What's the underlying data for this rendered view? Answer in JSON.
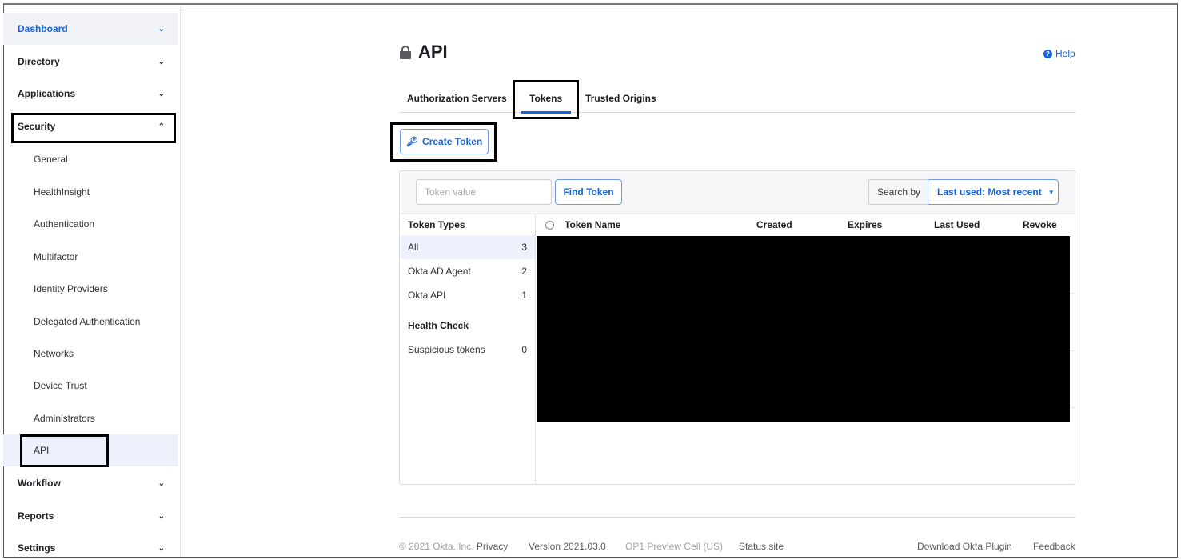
{
  "sidebar": {
    "items": [
      {
        "label": "Dashboard",
        "chevron": "chevron-down-icon"
      },
      {
        "label": "Directory",
        "chevron": "chevron-down-icon"
      },
      {
        "label": "Applications",
        "chevron": "chevron-down-icon"
      },
      {
        "label": "Security",
        "chevron": "chevron-up-icon"
      },
      {
        "label": "Workflow",
        "chevron": "chevron-down-icon"
      },
      {
        "label": "Reports",
        "chevron": "chevron-down-icon"
      },
      {
        "label": "Settings",
        "chevron": "chevron-down-icon"
      }
    ],
    "security_sub": [
      {
        "label": "General"
      },
      {
        "label": "HealthInsight"
      },
      {
        "label": "Authentication"
      },
      {
        "label": "Multifactor"
      },
      {
        "label": "Identity Providers"
      },
      {
        "label": "Delegated Authentication"
      },
      {
        "label": "Networks"
      },
      {
        "label": "Device Trust"
      },
      {
        "label": "Administrators"
      },
      {
        "label": "API"
      }
    ]
  },
  "header": {
    "title": "API",
    "title_icon": "lock-icon",
    "help_label": "Help",
    "help_icon": "question-circle-icon"
  },
  "tabs": [
    {
      "label": "Authorization Servers",
      "active": false
    },
    {
      "label": "Tokens",
      "active": true
    },
    {
      "label": "Trusted Origins",
      "active": false
    }
  ],
  "create_token": {
    "label": "Create Token",
    "icon": "key-add-icon"
  },
  "search": {
    "placeholder": "Token value",
    "value": "",
    "find_label": "Find Token",
    "search_by_label": "Search by",
    "sort_selected": "Last used: Most recent"
  },
  "token_types": {
    "heading": "Token Types",
    "items": [
      {
        "label": "All",
        "count": "3"
      },
      {
        "label": "Okta AD Agent",
        "count": "2"
      },
      {
        "label": "Okta API",
        "count": "1"
      }
    ],
    "health_heading": "Health Check",
    "health_items": [
      {
        "label": "Suspicious tokens",
        "count": "0"
      }
    ]
  },
  "table": {
    "columns": [
      "Token Name",
      "Created",
      "Expires",
      "Last Used",
      "Revoke"
    ],
    "rows_redacted": true
  },
  "footer": {
    "copyright": "© 2021 Okta, Inc.",
    "privacy": "Privacy",
    "version": "Version 2021.03.0",
    "cell": "OP1 Preview Cell (US)",
    "status": "Status site",
    "plugin": "Download Okta Plugin",
    "feedback": "Feedback"
  }
}
